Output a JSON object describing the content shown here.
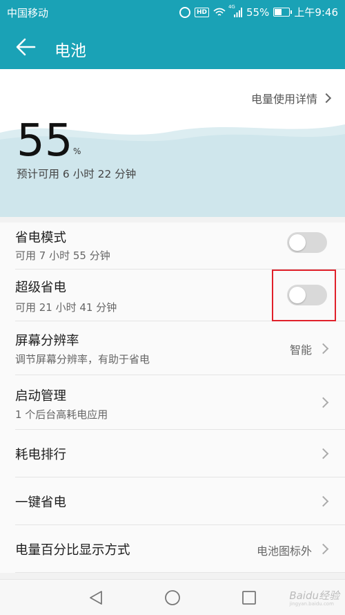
{
  "status_bar": {
    "carrier": "中国移动",
    "icons": [
      "alarm-icon",
      "hd-icon",
      "wifi-icon",
      "signal-4g-icon",
      "battery-icon"
    ],
    "hd_label": "HD",
    "network_label": "4G",
    "battery_level": 0.55,
    "battery_percent": "55%",
    "time": "上午9:46"
  },
  "header": {
    "title": "电池",
    "back_icon": "arrow-left-icon",
    "accent_color": "#1aa2b6"
  },
  "battery": {
    "usage_details_link": "电量使用详情",
    "percent_value": "55",
    "percent_unit": "%",
    "estimate": "预计可用 6 小时 22 分钟"
  },
  "settings": [
    {
      "label": "省电模式",
      "sub": "可用 7 小时 55 分钟",
      "toggle_on": false
    },
    {
      "label": "超级省电",
      "sub": "可用 21 小时 41 分钟",
      "toggle_on": false
    },
    {
      "label": "屏幕分辨率",
      "sub": "调节屏幕分辨率，有助于省电",
      "value": "智能"
    },
    {
      "label": "启动管理",
      "sub": "1 个后台高耗电应用"
    },
    {
      "label": "耗电排行"
    },
    {
      "label": "一键省电"
    },
    {
      "label": "电量百分比显示方式",
      "value": "电池图标外"
    }
  ],
  "annotation_color": "#e0202a",
  "nav": {
    "icons": [
      "back-triangle-icon",
      "home-circle-icon",
      "recents-square-icon"
    ]
  },
  "watermark": {
    "text": "Baidu经验",
    "url": "jingyan.baidu.com"
  }
}
